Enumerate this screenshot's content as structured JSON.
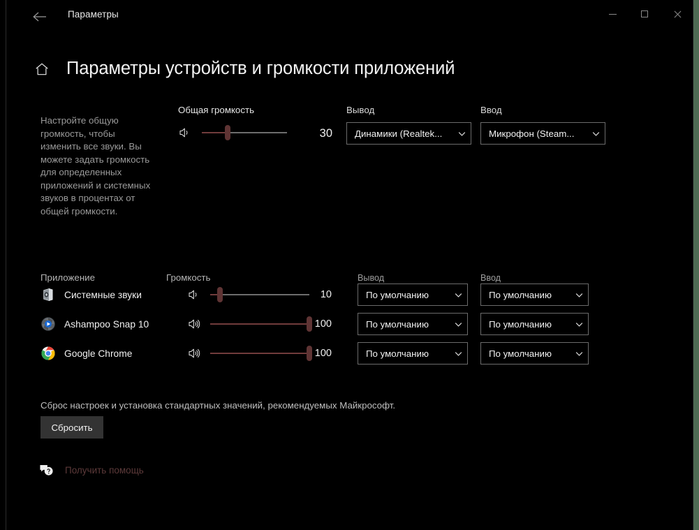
{
  "window": {
    "titlebar_text": "Параметры",
    "back_icon": "back-arrow-icon",
    "minimize_label": "–",
    "maximize_label": "□",
    "close_label": "✕"
  },
  "header": {
    "home_icon": "home-icon",
    "title": "Параметры устройств и громкости приложений"
  },
  "description": "Настройте общую громкость, чтобы изменить все звуки. Вы можете задать громкость для определенных приложений и системных звуков в процентах от общей громкости.",
  "master": {
    "volume_label": "Общая громкость",
    "volume_value": "30",
    "volume_percent": 30,
    "speaker_icon": "speaker-low-icon",
    "output_label": "Вывод",
    "output_value": "Динамики (Realtek...",
    "input_label": "Ввод",
    "input_value": "Микрофон (Steam..."
  },
  "apps_table": {
    "columns": {
      "app": "Приложение",
      "volume": "Громкость",
      "output": "Вывод",
      "input": "Ввод"
    },
    "rows": [
      {
        "name": "Системные звуки",
        "icon": "system-sounds-icon",
        "speaker_icon": "speaker-low-icon",
        "volume_value": "10",
        "volume_percent": 10,
        "output": "По умолчанию",
        "input": "По умолчанию"
      },
      {
        "name": "Ashampoo Snap 10",
        "icon": "ashampoo-snap-icon",
        "speaker_icon": "speaker-high-icon",
        "volume_value": "100",
        "volume_percent": 100,
        "output": "По умолчанию",
        "input": "По умолчанию"
      },
      {
        "name": "Google Chrome",
        "icon": "google-chrome-icon",
        "speaker_icon": "speaker-high-icon",
        "volume_value": "100",
        "volume_percent": 100,
        "output": "По умолчанию",
        "input": "По умолчанию"
      }
    ]
  },
  "reset": {
    "text": "Сброс настроек и установка стандартных значений, рекомендуемых Майкрософт.",
    "button_label": "Сбросить"
  },
  "help": {
    "icon": "help-bubble-icon",
    "label": "Получить помощь"
  },
  "colors": {
    "background": "#000000",
    "accent_slider": "#5f3434",
    "accent_fill": "#713c3c",
    "track": "#6d6d6d",
    "help_link": "#5d3a3a",
    "desktop_edge": "#4e6a53"
  }
}
